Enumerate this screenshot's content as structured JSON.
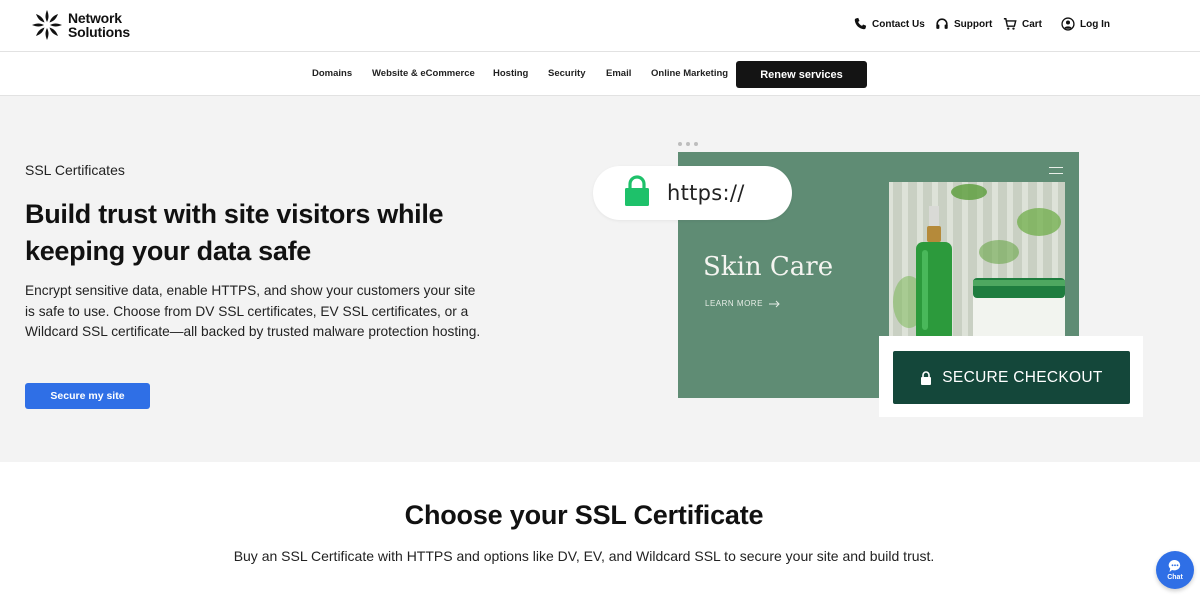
{
  "brand": {
    "line1": "Network",
    "line2": "Solutions"
  },
  "utility_nav": [
    {
      "label": "Contact Us",
      "icon": "phone-icon"
    },
    {
      "label": "Support",
      "icon": "headset-icon"
    },
    {
      "label": "Cart",
      "icon": "cart-icon"
    },
    {
      "label": "Log In",
      "icon": "user-icon"
    }
  ],
  "main_nav": {
    "items": [
      "Domains",
      "Website & eCommerce",
      "Hosting",
      "Security",
      "Email",
      "Online Marketing"
    ],
    "renew_label": "Renew services"
  },
  "hero": {
    "eyebrow": "SSL Certificates",
    "title": "Build trust with site visitors while keeping your data safe",
    "description": "Encrypt sensitive data, enable HTTPS, and show your customers your site is safe to use. Choose from DV SSL certificates, EV SSL certificates, or a Wildcard SSL certificate—all backed by trusted malware protection hosting.",
    "cta_label": "Secure my site"
  },
  "illustration": {
    "url_text": "https://",
    "site_title": "Skin Care",
    "learn_more": "LEARN MORE",
    "checkout_label": "SECURE CHECKOUT"
  },
  "section": {
    "title": "Choose your SSL Certificate",
    "subtitle": "Buy an SSL Certificate with HTTPS and options like DV, EV, and Wildcard SSL to secure your site and build trust."
  },
  "chat": {
    "label": "Chat"
  },
  "colors": {
    "primary_blue": "#2f6fe6",
    "dark_button": "#141414",
    "sage_green": "#5f8c74",
    "checkout_green": "#14473a",
    "lock_green": "#1ec16a",
    "hero_bg": "#f3f3f3"
  }
}
